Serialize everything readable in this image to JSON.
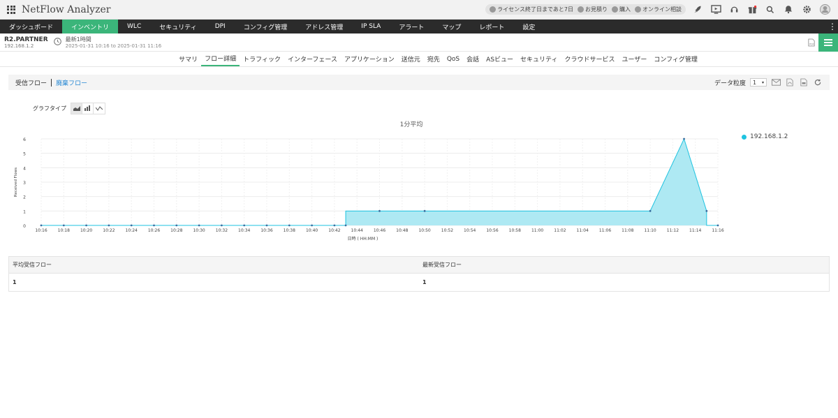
{
  "app": {
    "title": "NetFlow Analyzer"
  },
  "topbar": {
    "license": "ライセンス終了日まであと7日",
    "quote": "お見積り",
    "buy": "購入",
    "consult": "オンライン相談"
  },
  "nav": {
    "items": [
      {
        "label": "ダッシュボード"
      },
      {
        "label": "インベントリ"
      },
      {
        "label": "WLC"
      },
      {
        "label": "セキュリティ"
      },
      {
        "label": "DPI"
      },
      {
        "label": "コンフィグ管理"
      },
      {
        "label": "アドレス管理"
      },
      {
        "label": "IP SLA"
      },
      {
        "label": "アラート"
      },
      {
        "label": "マップ"
      },
      {
        "label": "レポート"
      },
      {
        "label": "設定"
      }
    ],
    "active_index": 1
  },
  "device": {
    "name": "R2.PARTNER",
    "ip": "192.168.1.2",
    "time_label": "最新1時間",
    "time_range": "2025-01-31 10:16 to 2025-01-31 11:16"
  },
  "subnav": {
    "items": [
      {
        "label": "サマリ"
      },
      {
        "label": "フロー詳細"
      },
      {
        "label": "トラフィック"
      },
      {
        "label": "インターフェース"
      },
      {
        "label": "アプリケーション"
      },
      {
        "label": "送信元"
      },
      {
        "label": "宛先"
      },
      {
        "label": "QoS"
      },
      {
        "label": "会話"
      },
      {
        "label": "ASビュー"
      },
      {
        "label": "セキュリティ"
      },
      {
        "label": "クラウドサービス"
      },
      {
        "label": "ユーザー"
      },
      {
        "label": "コンフィグ管理"
      }
    ],
    "active_index": 1
  },
  "flows": {
    "received_tab": "受信フロー",
    "dropped_link": "廃棄フロー",
    "granularity_label": "データ粒度",
    "granularity_value": "1"
  },
  "graph": {
    "type_label": "グラフタイプ"
  },
  "chart_data": {
    "type": "area",
    "title": "1分平均",
    "xlabel": "日時 ( HH:MM )",
    "ylabel": "Received Flows",
    "ylim": [
      0,
      6
    ],
    "yticks": [
      0,
      1,
      2,
      3,
      4,
      5,
      6
    ],
    "xlim": [
      "10:16",
      "11:16"
    ],
    "xticks": [
      "10:16",
      "10:18",
      "10:20",
      "10:22",
      "10:24",
      "10:26",
      "10:28",
      "10:30",
      "10:32",
      "10:34",
      "10:36",
      "10:38",
      "10:40",
      "10:42",
      "10:44",
      "10:46",
      "10:48",
      "10:50",
      "10:52",
      "10:54",
      "10:56",
      "10:58",
      "11:00",
      "11:02",
      "11:04",
      "11:06",
      "11:08",
      "11:10",
      "11:12",
      "11:14",
      "11:16"
    ],
    "grid": true,
    "legend_position": "right",
    "color": "#1ec3e0",
    "fill": "#aee9f3",
    "series": [
      {
        "name": "192.168.1.2",
        "points": [
          [
            "10:16",
            0
          ],
          [
            "10:18",
            0
          ],
          [
            "10:20",
            0
          ],
          [
            "10:22",
            0
          ],
          [
            "10:24",
            0
          ],
          [
            "10:26",
            0
          ],
          [
            "10:28",
            0
          ],
          [
            "10:30",
            0
          ],
          [
            "10:32",
            0
          ],
          [
            "10:34",
            0
          ],
          [
            "10:36",
            0
          ],
          [
            "10:38",
            0
          ],
          [
            "10:40",
            0
          ],
          [
            "10:42",
            0
          ],
          [
            "10:43",
            0
          ],
          [
            "10:43",
            1
          ],
          [
            "10:46",
            1
          ],
          [
            "10:50",
            1
          ],
          [
            "11:10",
            1
          ],
          [
            "11:13",
            6
          ],
          [
            "11:15",
            1
          ],
          [
            "11:15",
            0
          ],
          [
            "11:16",
            0
          ]
        ]
      }
    ]
  },
  "stats": {
    "avg_label": "平均受信フロー",
    "latest_label": "最新受信フロー",
    "avg_value": "1",
    "latest_value": "1"
  }
}
